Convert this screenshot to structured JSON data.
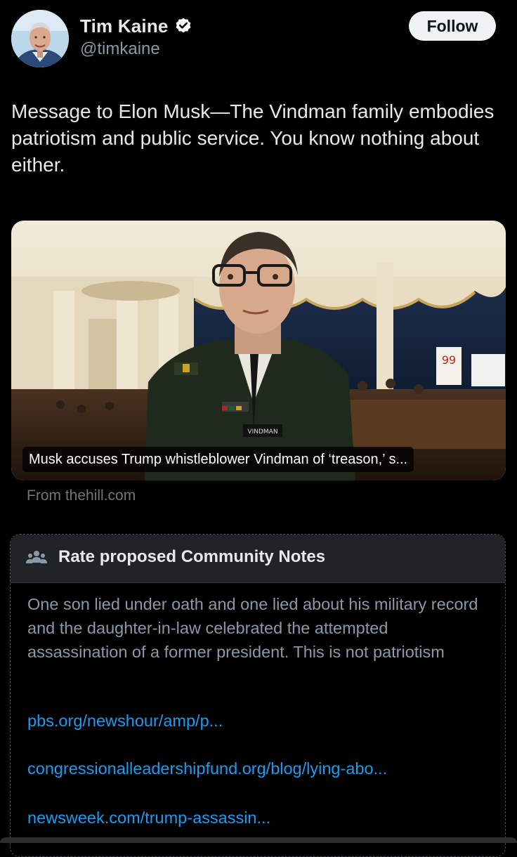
{
  "author": {
    "display_name": "Tim Kaine",
    "handle": "@timkaine",
    "verified": true,
    "follow_label": "Follow"
  },
  "tweet": {
    "text": "Message to Elon Musk—The Vindman family embodies patriotism and public service.  You know nothing about either."
  },
  "link_card": {
    "caption": "Musk accuses Trump whistleblower Vindman of ‘treason,’ s...",
    "source": "From thehill.com",
    "image_label": "VINDMAN",
    "sign_number": "99"
  },
  "community_notes": {
    "title": "Rate proposed Community Notes",
    "body": "One son lied under oath and one lied about his military record and the daughter-in-law celebrated the attempted assassination of a former president. This is not patriotism",
    "links": [
      "pbs.org/newshour/amp/p...",
      "congressionalleadershipfund.org/blog/lying-abo...",
      "newsweek.com/trump-assassin..."
    ]
  },
  "colors": {
    "background": "#000000",
    "text_primary": "#e7e9ea",
    "text_secondary": "#8b98a5",
    "link": "#1d9bf0",
    "verified_badge": "#ffffff",
    "notes_header_bg": "#202327"
  },
  "icons": {
    "verified": "verified-badge-icon",
    "community_notes": "community-notes-people-icon"
  }
}
